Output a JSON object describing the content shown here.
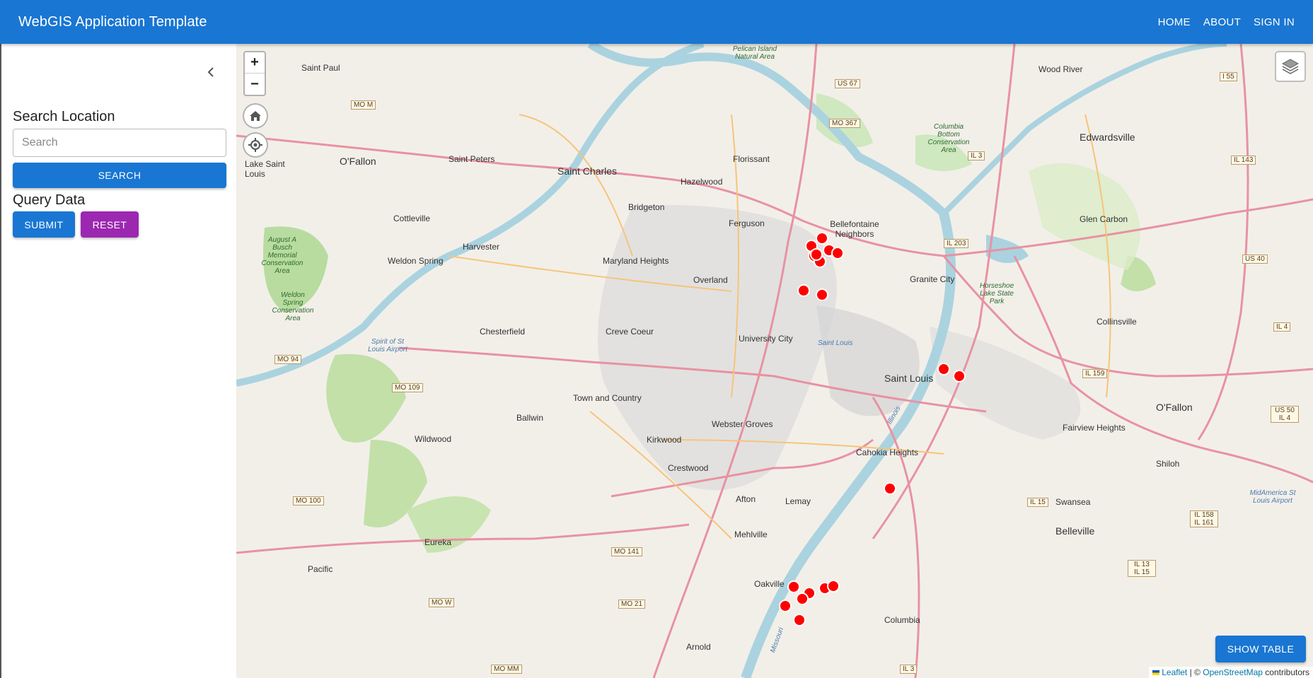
{
  "header": {
    "title": "WebGIS Application Template",
    "nav": [
      "HOME",
      "ABOUT",
      "SIGN IN"
    ]
  },
  "sidebar": {
    "collapse_icon": "chevron-left-icon",
    "search_title": "Search Location",
    "search_placeholder": "Search",
    "search_button": "SEARCH",
    "query_title": "Query Data",
    "submit_button": "SUBMIT",
    "reset_button": "RESET"
  },
  "map": {
    "zoom_in": "+",
    "zoom_out": "−",
    "show_table_button": "SHOW TABLE",
    "attribution": {
      "leaflet": "Leaflet",
      "separator": "| ©",
      "osm": "OpenStreetMap",
      "contributors": "contributors"
    },
    "labels": {
      "big": [
        "Saint Charles",
        "Saint Louis",
        "Belleville",
        "Edwardsville",
        "O'Fallon"
      ],
      "places": [
        "Saint Paul",
        "O'Fallon",
        "Lake Saint Louis",
        "Saint Peters",
        "Cottleville",
        "Harvester",
        "Weldon Spring",
        "Chesterfield",
        "Florissant",
        "Hazelwood",
        "Bridgeton",
        "Ferguson",
        "Bellefontaine Neighbors",
        "Maryland Heights",
        "Overland",
        "Creve Coeur",
        "University City",
        "Ballwin",
        "Town and Country",
        "Kirkwood",
        "Webster Groves",
        "Wildwood",
        "Crestwood",
        "Afton",
        "Lemay",
        "Mehlville",
        "Oakville",
        "Arnold",
        "Eureka",
        "Pacific",
        "Granite City",
        "Glen Carbon",
        "Collinsville",
        "Wood River",
        "Fairview Heights",
        "Cahokia Heights",
        "Swansea",
        "Shiloh",
        "Columbia"
      ],
      "parks": [
        "August A Busch Memorial Conservation Area",
        "Weldon Spring Conservation Area",
        "Columbia Bottom Conservation Area",
        "Horseshoe Lake State Park",
        "Pelican Island Natural Area"
      ],
      "airports": [
        "Spirit of St Louis Airport",
        "MidAmerica St Louis Airport"
      ],
      "water": [
        "Saint Louis",
        "Illinois",
        "Missouri"
      ],
      "shields": [
        "MO M",
        "US 67",
        "MO 367",
        "IL 3",
        "I 55",
        "IL 143",
        "IL 203",
        "US 40",
        "IL 4",
        "IL 159",
        "US 50 IL 4",
        "MO 94",
        "MO 109",
        "MO 100",
        "IL 15",
        "IL 158 IL 161",
        "IL 13 IL 15",
        "MO 141",
        "MO W",
        "MO 21",
        "MO MM",
        "IL 3"
      ]
    }
  },
  "colors": {
    "primary": "#1976d2",
    "reset": "#9c27b0",
    "marker": "#ff0000"
  }
}
